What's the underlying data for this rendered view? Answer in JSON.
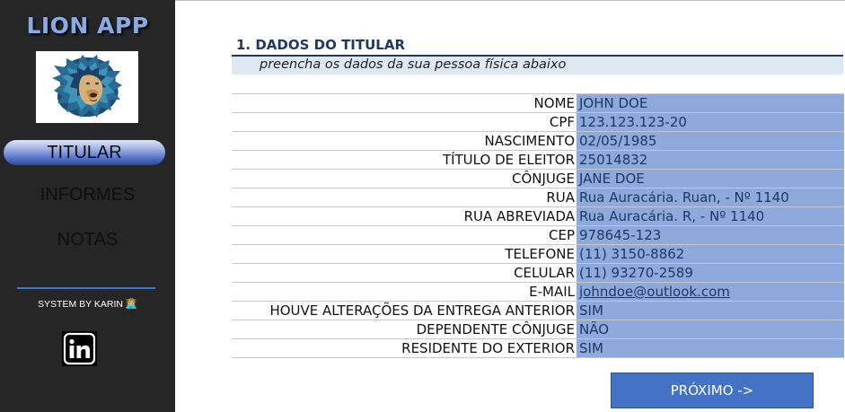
{
  "sidebar": {
    "app_title": "LION APP",
    "logo_icon": "lion-head-logo",
    "nav": [
      {
        "label": "TITULAR",
        "active": true
      },
      {
        "label": "INFORMES",
        "active": false
      },
      {
        "label": "NOTAS",
        "active": false
      }
    ],
    "credit": "SYSTEM BY KARIN 👩🏼‍💻",
    "social_icon": "linkedin-icon"
  },
  "section": {
    "title": "1. DADOS DO TITULAR",
    "subtitle": "preencha os dados da sua pessoa física abaixo"
  },
  "fields": [
    {
      "label": "NOME",
      "value": "JOHN DOE"
    },
    {
      "label": "CPF",
      "value": "123.123.123-20"
    },
    {
      "label": "NASCIMENTO",
      "value": "02/05/1985"
    },
    {
      "label": "TÍTULO DE ELEITOR",
      "value": "25014832"
    },
    {
      "label": "CÔNJUGE",
      "value": "JANE DOE"
    },
    {
      "label": "RUA",
      "value": "Rua Auracária. Ruan, - Nº 1140"
    },
    {
      "label": "RUA ABREVIADA",
      "value": "Rua Auracária. R, - Nº 1140"
    },
    {
      "label": "CEP",
      "value": "978645-123"
    },
    {
      "label": "TELEFONE",
      "value": "(11) 3150-8862"
    },
    {
      "label": "CELULAR",
      "value": "(11) 93270-2589"
    },
    {
      "label": "E-MAIL",
      "value": "johndoe@outlook.com"
    },
    {
      "label": "HOUVE ALTERAÇÕES DA ENTREGA ANTERIOR",
      "value": "SIM"
    },
    {
      "label": "DEPENDENTE CÔNJUGE",
      "value": "NÃO"
    },
    {
      "label": "RESIDENTE DO EXTERIOR",
      "value": "SIM"
    }
  ],
  "next_button": "PRÓXIMO ->",
  "colors": {
    "sidebar_bg": "#262626",
    "accent_blue": "#4472c4",
    "value_cell_bg": "#8ea9db",
    "title_navy": "#1f3864"
  }
}
